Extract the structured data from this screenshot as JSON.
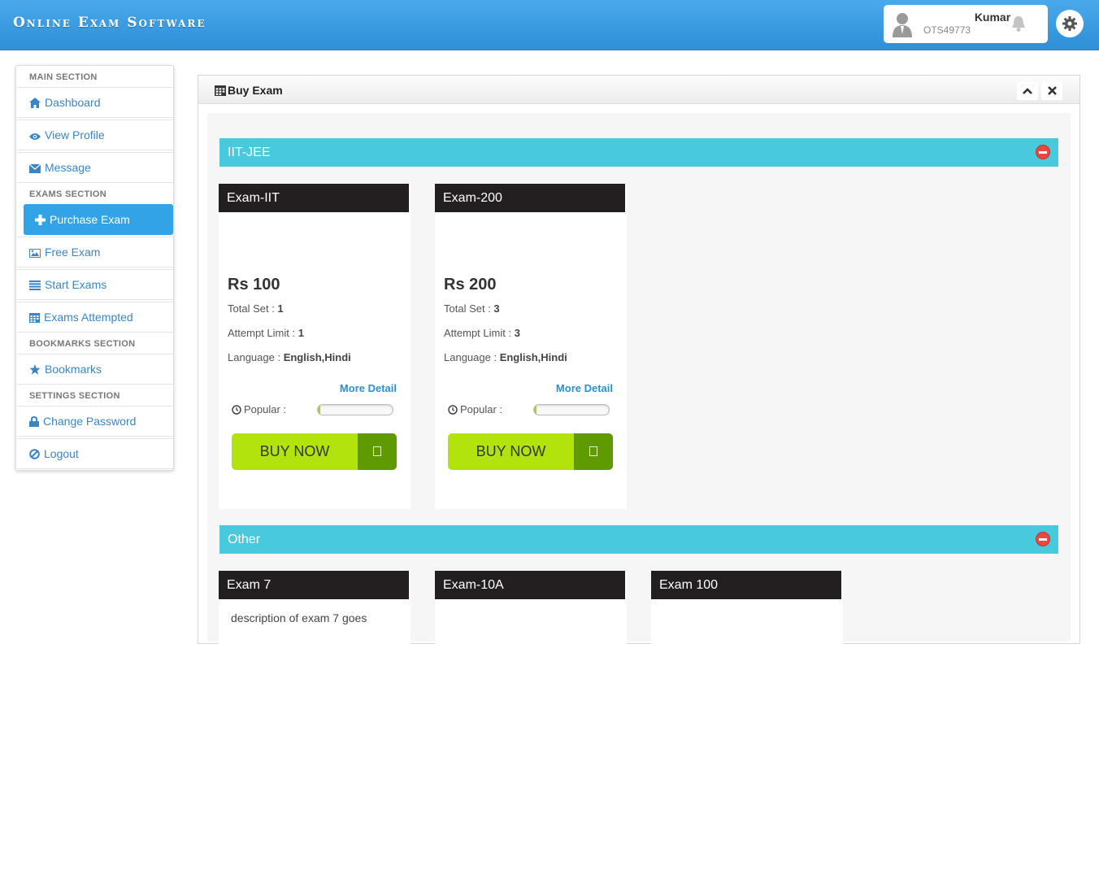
{
  "header": {
    "app_title": "Online Exam Software",
    "user_name": "Kumar",
    "user_id": "OTS49773"
  },
  "sidebar": {
    "sections": {
      "main": "MAIN SECTION",
      "exams": "EXAMS SECTION",
      "bookmarks": "BOOKMARKS SECTION",
      "settings": "SETTINGS SECTION"
    },
    "items": {
      "dashboard": "Dashboard",
      "view_profile": "View Profile",
      "message": "Message",
      "purchase_exam": "Purchase Exam",
      "free_exam": "Free Exam",
      "start_exams": "Start Exams",
      "exams_attempted": "Exams Attempted",
      "bookmarks": "Bookmarks",
      "change_password": "Change Password",
      "logout": "Logout"
    },
    "active_item": "purchase_exam"
  },
  "panel": {
    "title": "Buy Exam"
  },
  "categories": [
    {
      "name": "IIT-JEE",
      "exams": [
        {
          "title": "Exam-IIT",
          "price": "Rs 100",
          "total_set_label": "Total Set : ",
          "total_set": "1",
          "attempt_label": "Attempt Limit : ",
          "attempt_limit": "1",
          "language_label": "Language : ",
          "language": "English,Hindi",
          "more": "More Detail",
          "popular_label": "Popular :",
          "popularity": 0.03,
          "buy_label": "BUY NOW"
        },
        {
          "title": "Exam-200",
          "price": "Rs 200",
          "total_set_label": "Total Set : ",
          "total_set": "3",
          "attempt_label": "Attempt Limit : ",
          "attempt_limit": "3",
          "language_label": "Language : ",
          "language": "English,Hindi",
          "more": "More Detail",
          "popular_label": "Popular :",
          "popularity": 0.03,
          "buy_label": "BUY NOW"
        }
      ]
    },
    {
      "name": "Other",
      "exams": [
        {
          "title": "Exam 7",
          "description": "description of exam 7 goes"
        },
        {
          "title": "Exam-10A"
        },
        {
          "title": "Exam 100"
        }
      ]
    }
  ],
  "colors": {
    "header": "#2e8fd8",
    "category_bar": "#48c9dd",
    "card_header": "#231f20",
    "buy_button": "#b2e30c",
    "buy_icon": "#5f9a00",
    "active_nav": "#31a3e6"
  }
}
